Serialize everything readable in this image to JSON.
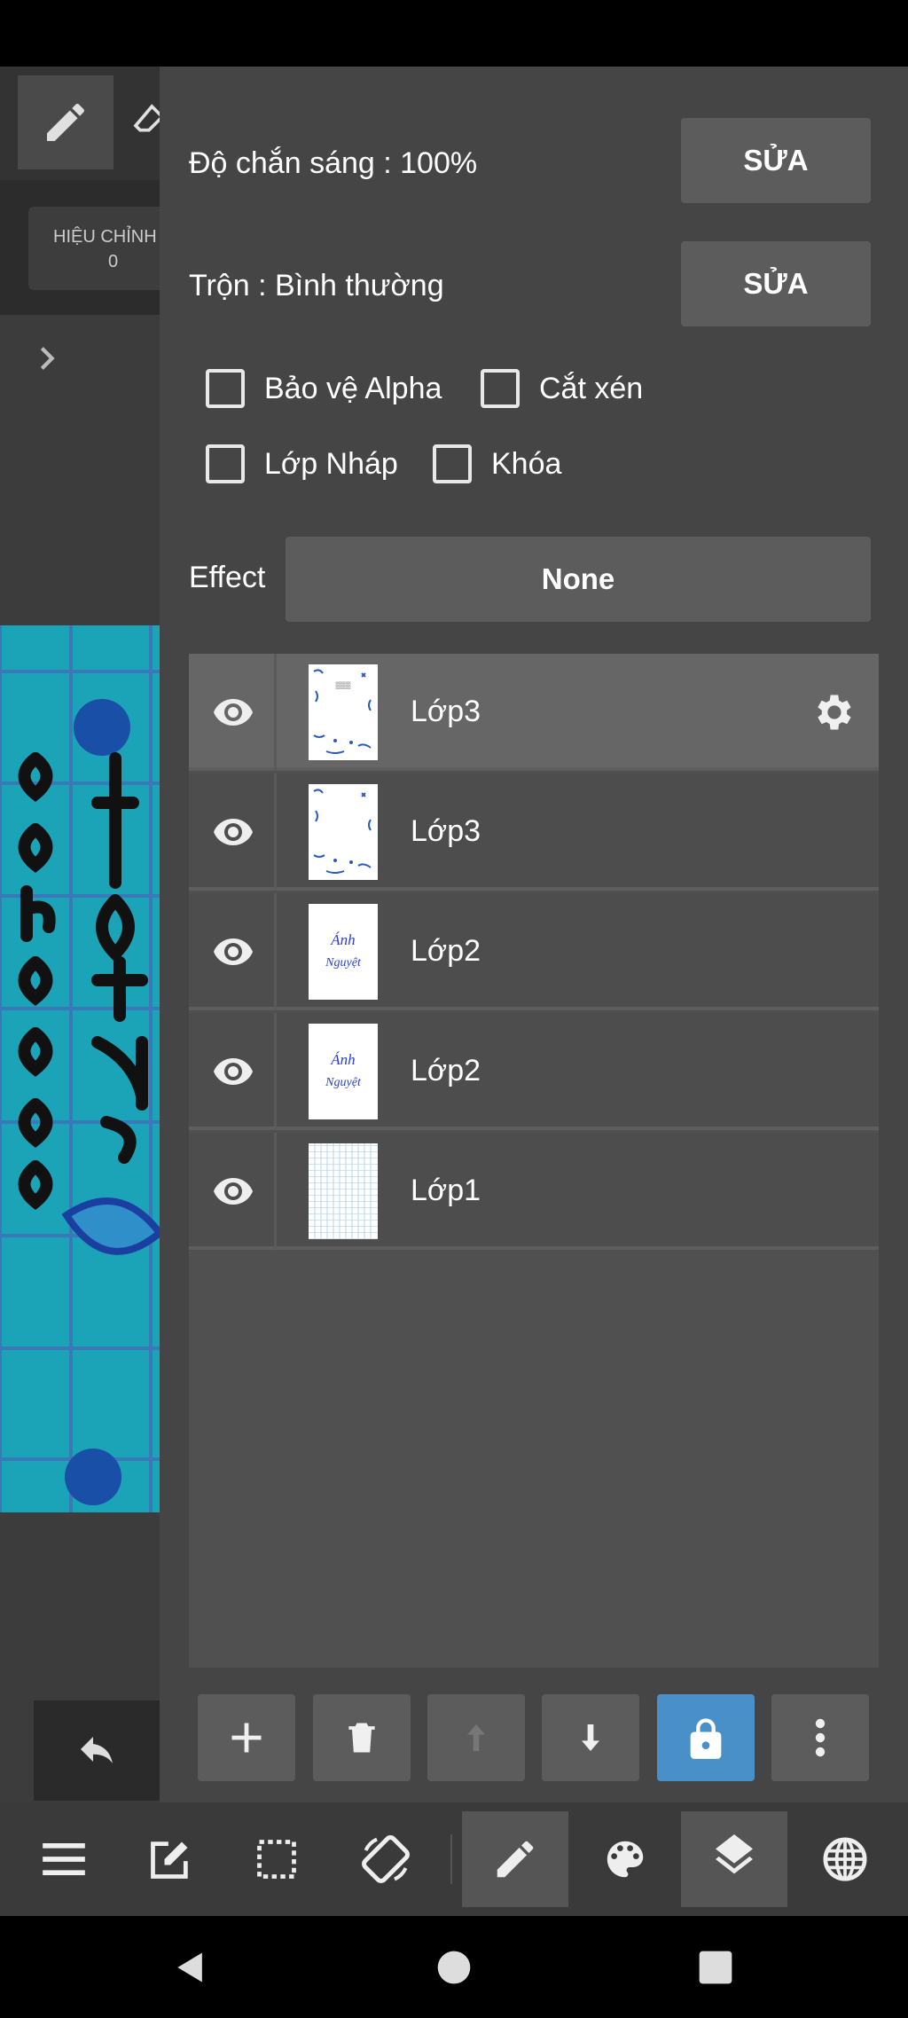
{
  "left": {
    "adjust_label": "HIỆU CHỈNH",
    "adjust_value": "0"
  },
  "panel": {
    "opacity_label": "Độ chắn sáng : 100%",
    "opacity_edit": "SỬA",
    "blend_label": "Trộn : Bình thường",
    "blend_edit": "SỬA",
    "checkboxes": {
      "alpha": "Bảo vệ Alpha",
      "clip": "Cắt xén",
      "draft": "Lớp Nháp",
      "lock": "Khóa"
    },
    "effect_label": "Effect",
    "effect_value": "None"
  },
  "layers": [
    {
      "name": "Lớp3",
      "selected": true,
      "thumb": "ornament-text"
    },
    {
      "name": "Lớp3",
      "selected": false,
      "thumb": "ornament"
    },
    {
      "name": "Lớp2",
      "selected": false,
      "thumb": "text"
    },
    {
      "name": "Lớp2",
      "selected": false,
      "thumb": "text"
    },
    {
      "name": "Lớp1",
      "selected": false,
      "thumb": "grid"
    }
  ],
  "thumb_text": {
    "line1": "Ánh",
    "line2": "Nguyệt"
  },
  "colors": {
    "panel_bg": "#454545",
    "button_bg": "#5c5c5c",
    "active_blue": "#4a90c8",
    "canvas_teal": "#1ba3b8"
  }
}
